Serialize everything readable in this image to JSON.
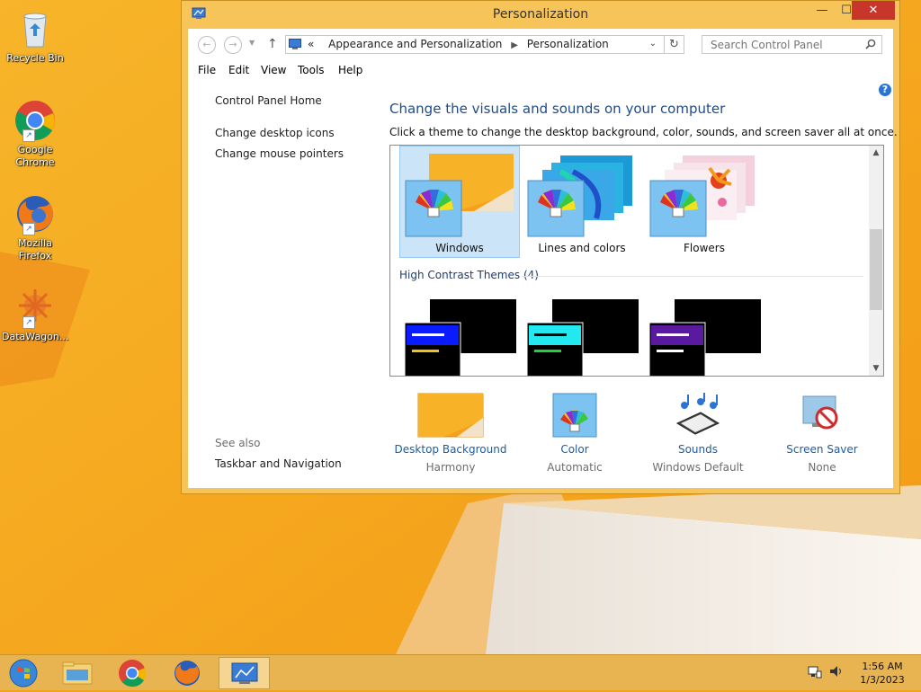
{
  "desktop": {
    "icons": [
      {
        "label": "Recycle Bin",
        "shortcut": false
      },
      {
        "label": "Google Chrome",
        "shortcut": true
      },
      {
        "label": "Mozilla Firefox",
        "shortcut": true
      },
      {
        "label": "DataWagon...",
        "shortcut": true
      }
    ]
  },
  "window": {
    "title": "Personalization",
    "buttons": {
      "minimize": "—",
      "maximize": "☐",
      "close": "✕"
    },
    "address": {
      "overflow": "«",
      "crumbs": [
        "Appearance and Personalization",
        "Personalization"
      ]
    },
    "search": {
      "placeholder": "Search Control Panel"
    },
    "menu": [
      "File",
      "Edit",
      "View",
      "Tools",
      "Help"
    ]
  },
  "left_pane": {
    "home": "Control Panel Home",
    "links": [
      "Change desktop icons",
      "Change mouse pointers"
    ],
    "see_also_label": "See also",
    "see_also_links": [
      "Taskbar and Navigation"
    ]
  },
  "main": {
    "help": "?",
    "heading": "Change the visuals and sounds on your computer",
    "subtext": "Click a theme to change the desktop background, color, sounds, and screen saver all at once.",
    "themes": [
      {
        "label": "Windows",
        "selected": true
      },
      {
        "label": "Lines and colors",
        "selected": false
      },
      {
        "label": "Flowers",
        "selected": false
      }
    ],
    "high_contrast_header": "High Contrast Themes (4)",
    "high_contrast_colors": [
      "#0a1cff",
      "#22e8f0",
      "#5a1aa0"
    ]
  },
  "settings": [
    {
      "title": "Desktop Background",
      "value": "Harmony"
    },
    {
      "title": "Color",
      "value": "Automatic"
    },
    {
      "title": "Sounds",
      "value": "Windows Default"
    },
    {
      "title": "Screen Saver",
      "value": "None"
    }
  ],
  "taskbar": {
    "clock_time": "1:56 AM",
    "clock_date": "1/3/2023"
  },
  "colors": {
    "accent_link": "#1e5ca3",
    "close_button": "#c7352b",
    "window_frame": "#f6c458",
    "selection": "#cce4f7"
  }
}
